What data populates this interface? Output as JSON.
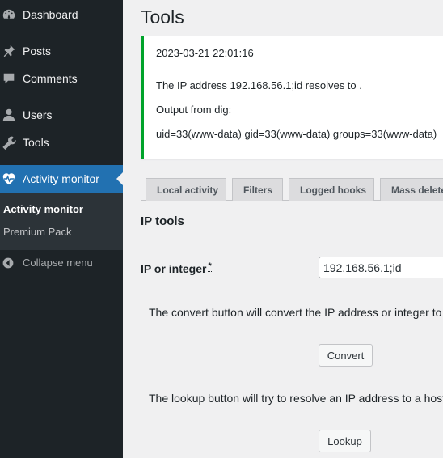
{
  "sidebar": {
    "items": [
      {
        "label": "Dashboard",
        "icon": "dashboard-icon"
      },
      {
        "label": "Posts",
        "icon": "pin-icon"
      },
      {
        "label": "Comments",
        "icon": "comment-icon"
      },
      {
        "label": "Users",
        "icon": "user-icon"
      },
      {
        "label": "Tools",
        "icon": "wrench-icon"
      },
      {
        "label": "Activity monitor",
        "icon": "heart-pulse-icon",
        "active": true
      }
    ],
    "submenu": [
      {
        "label": "Activity monitor",
        "current": true
      },
      {
        "label": "Premium Pack"
      }
    ],
    "collapse_label": "Collapse menu"
  },
  "page": {
    "title": "Tools"
  },
  "notice": {
    "timestamp": "2023-03-21 22:01:16",
    "resolve_line": "The IP address 192.168.56.1;id resolves to .",
    "output_label": "Output from dig:",
    "output_value": "uid=33(www-data) gid=33(www-data) groups=33(www-data)"
  },
  "tabs": [
    "Local activity",
    "Filters",
    "Logged hooks",
    "Mass delete"
  ],
  "ip_tools": {
    "title": "IP tools",
    "field_label": "IP or integer",
    "required_marker": "*",
    "input_value": "192.168.56.1;id",
    "convert_desc": "The convert button will convert the IP address or integer to",
    "convert_label": "Convert",
    "lookup_desc": "The lookup button will try to resolve an IP address to a host",
    "lookup_label": "Lookup"
  },
  "colors": {
    "accent": "#2271b1",
    "sidebar": "#1d2327",
    "notice_success": "#00a32a"
  }
}
